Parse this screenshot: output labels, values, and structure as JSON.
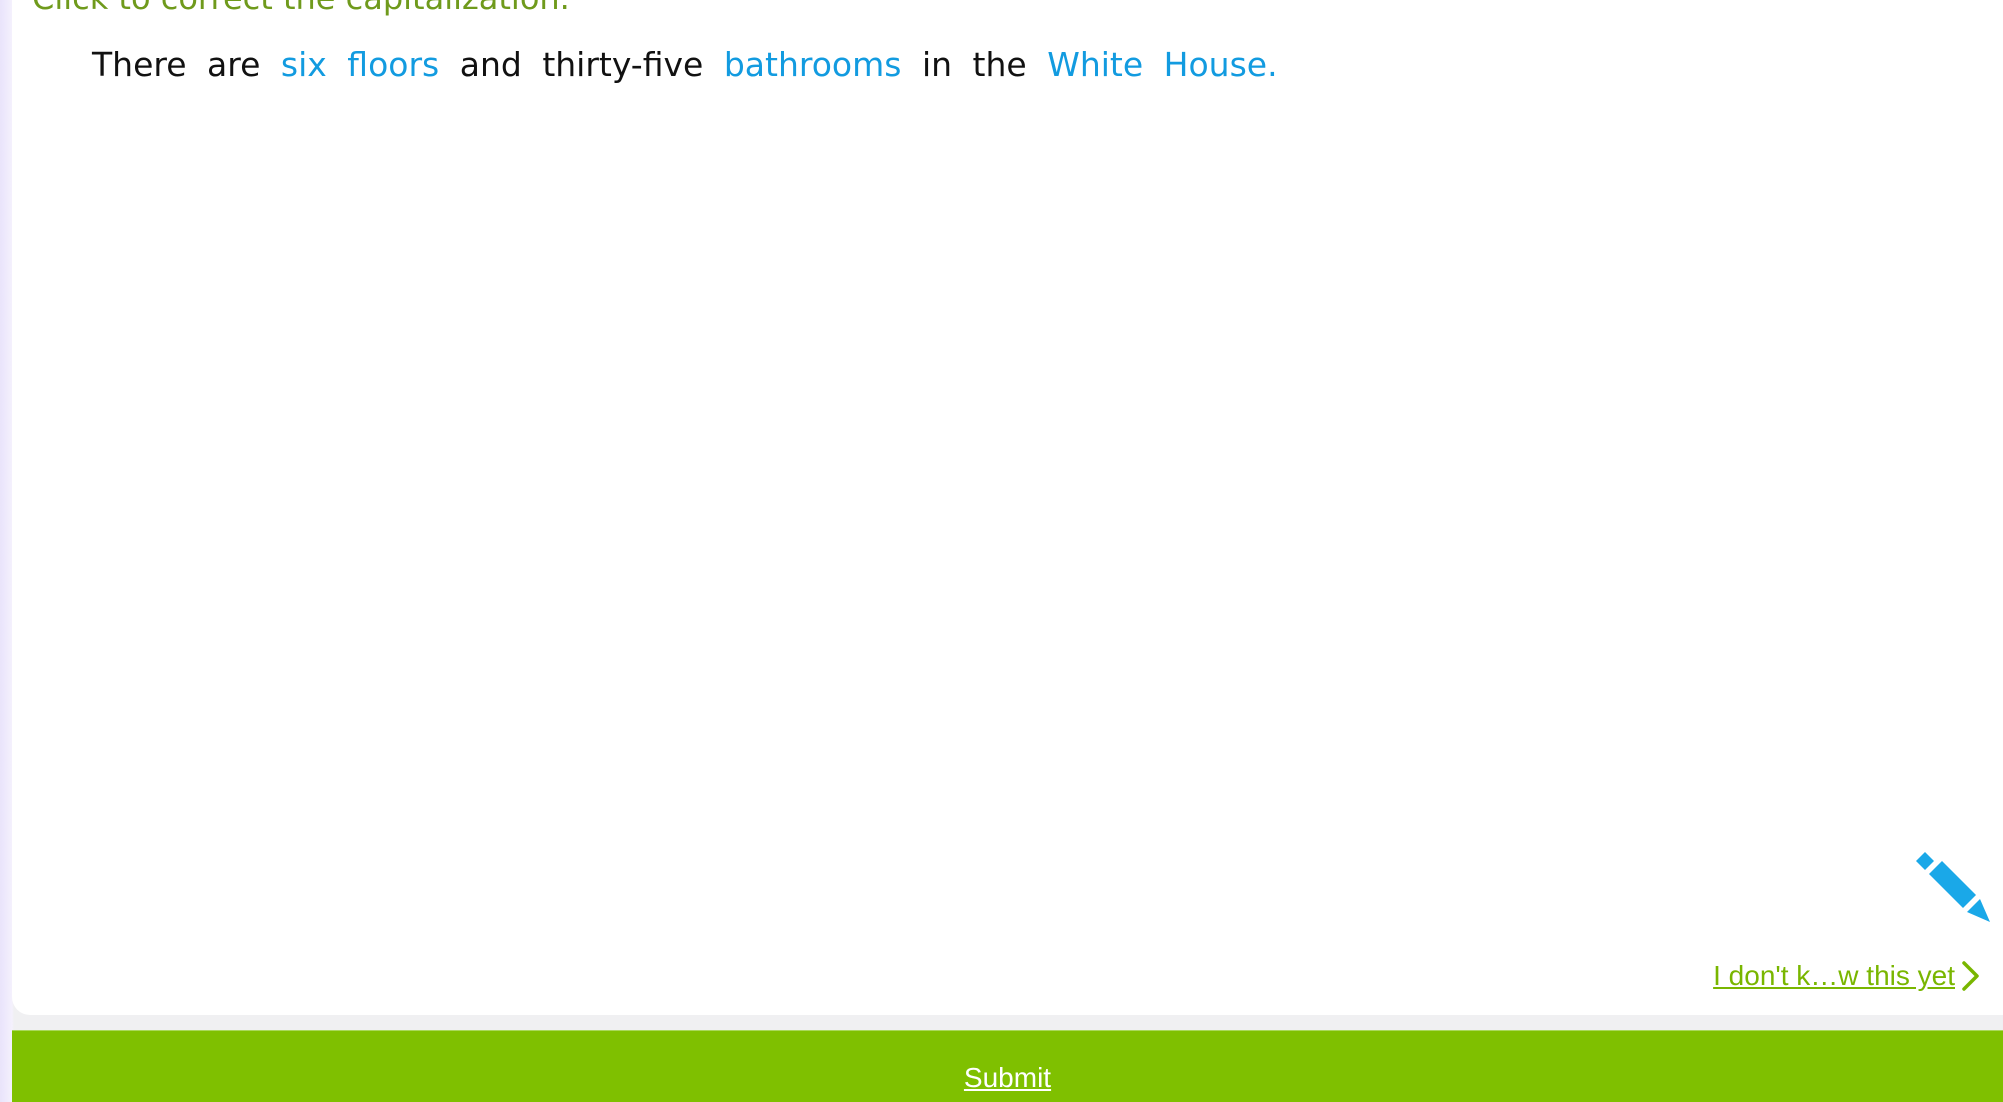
{
  "instruction": "Click to correct the capitalization.",
  "sentence": [
    {
      "text": "There",
      "clickable": false
    },
    {
      "text": "are",
      "clickable": false
    },
    {
      "text": "six",
      "clickable": true
    },
    {
      "text": "floors",
      "clickable": true
    },
    {
      "text": "and",
      "clickable": false
    },
    {
      "text": "thirty-five",
      "clickable": false
    },
    {
      "text": "bathrooms",
      "clickable": true
    },
    {
      "text": "in",
      "clickable": false
    },
    {
      "text": "the",
      "clickable": false
    },
    {
      "text": "White",
      "clickable": true
    },
    {
      "text": "House.",
      "clickable": true
    }
  ],
  "tools": {
    "pencil_icon": "pencil-icon"
  },
  "skip": {
    "label": "I don't k…w this yet",
    "icon": "chevron-right-icon"
  },
  "submit": {
    "label": "Submit"
  },
  "colors": {
    "instruction": "#6f9a1c",
    "clickable_word": "#129be0",
    "plain_word": "#111111",
    "submit_bar": "#7fc000",
    "skip_link": "#79b600",
    "pencil": "#1aa8e8"
  }
}
